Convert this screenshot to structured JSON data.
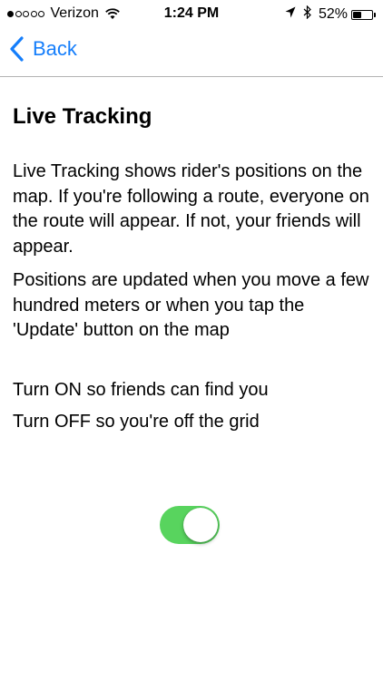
{
  "status_bar": {
    "carrier": "Verizon",
    "signal_bars_filled": 1,
    "signal_bars_total": 5,
    "time": "1:24 PM",
    "battery_percent": "52%",
    "battery_level": 0.52,
    "icons": [
      "wifi-icon",
      "location-arrow-icon",
      "bluetooth-icon",
      "battery-icon"
    ]
  },
  "nav": {
    "back_label": "Back",
    "accent_color": "#157efb"
  },
  "main": {
    "title": "Live Tracking",
    "paragraphs": [
      "Live Tracking shows rider's positions on the map. If you're following a route, everyone on the route will appear. If not, your friends will appear.",
      "Positions are updated when you move a few hundred meters or when you tap the 'Update' button on the map",
      "Turn ON so friends can find you",
      "Turn OFF so you're off the grid"
    ]
  },
  "toggle": {
    "state": "on",
    "on_color": "#58d45e"
  }
}
